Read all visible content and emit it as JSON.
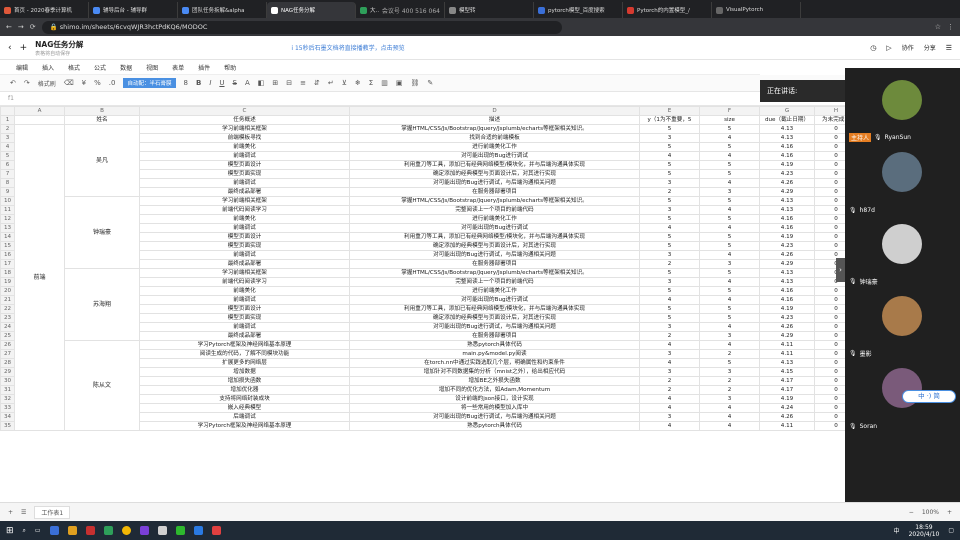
{
  "browser": {
    "tabs": [
      {
        "title": "首页 - 2020春季计算机",
        "icon_color": "#e0583a"
      },
      {
        "title": "辅导后台 - 辅导群",
        "icon_color": "#4a8af4"
      },
      {
        "title": "团队任务拆解&alpha",
        "icon_color": "#4a8af4"
      },
      {
        "title": "NAG任务分解",
        "icon_color": "#ffffff",
        "active": true
      },
      {
        "title": "大规与Pytor",
        "icon_color": "#2e9f5a",
        "overlay": "会议号 400 516 064"
      },
      {
        "title": "模型转",
        "icon_color": "#888888"
      },
      {
        "title": "pytorch模型_百度搜索",
        "icon_color": "#3a6fd8"
      },
      {
        "title": "Pytorch的内置模型_/",
        "icon_color": "#d63a2f"
      },
      {
        "title": "VisualPytorch",
        "icon_color": "#666666"
      }
    ],
    "url": "shimo.im/sheets/6cvqWJR3hctPdKQ6/MODOC"
  },
  "doc": {
    "title": "NAG任务分解",
    "subtitle": "表格将自动保存",
    "notice": "i 15秒后石墨文档将直接播教学，点击预览",
    "collab_button": "协作",
    "share_button": "分享"
  },
  "menu": [
    "编辑",
    "插入",
    "格式",
    "公式",
    "数据",
    "视图",
    "表单",
    "插件",
    "帮助"
  ],
  "toolbar": {
    "format_brush": "格式刷",
    "percent": "%",
    "font_size": "8",
    "highlight_button": "自动配：半石膏膜"
  },
  "sheet": {
    "cell_ref": "f1",
    "col_letters": [
      "A",
      "B",
      "C",
      "D",
      "E",
      "F",
      "G",
      "H"
    ],
    "headers": [
      "",
      "姓名",
      "任务概述",
      "描述",
      "y（1为不重要，5",
      "size",
      "due（截止日期）",
      "为未完成，"
    ],
    "group_label": "前端",
    "merges": [
      {
        "name": "吴凡",
        "start": 0,
        "span": 8
      },
      {
        "name": "钟瑞豪",
        "start": 8,
        "span": 8
      },
      {
        "name": "苏海翔",
        "start": 16,
        "span": 8
      },
      {
        "name": "陈从文",
        "start": 24,
        "span": 10
      }
    ],
    "rows": [
      [
        "学习前端相关框架",
        "掌握HTML/CSS/Js/Bootstrap/Jquery/Jsplumb/echarts等框架相关知识。",
        "5",
        "5",
        "4.13",
        "0"
      ],
      [
        "前端模板寻找",
        "找到合适的前端模板",
        "3",
        "4",
        "4.13",
        "0"
      ],
      [
        "前端美化",
        "进行前端美化工作",
        "5",
        "5",
        "4.16",
        "0"
      ],
      [
        "前端调试",
        "对可能出现的Bug进行调试",
        "4",
        "4",
        "4.16",
        "0"
      ],
      [
        "模型页面设计",
        "利用重刀等工具，添加已有经典网络模型/模块化，并与后端沟通具体实现",
        "5",
        "5",
        "4.19",
        "0"
      ],
      [
        "模型页面实现",
        "确定添加的经典模型与页面设计后，对其进行实现",
        "5",
        "5",
        "4.23",
        "0"
      ],
      [
        "前端调试",
        "对可能出现的Bug进行调试，与后端沟通相关问题",
        "3",
        "4",
        "4.26",
        "0"
      ],
      [
        "最终成品部署",
        "在服务器部署项目",
        "2",
        "3",
        "4.29",
        "0"
      ],
      [
        "学习前端相关框架",
        "掌握HTML/CSS/Js/Bootstrap/Jquery/Jsplumb/echarts等框架相关知识。",
        "5",
        "5",
        "4.13",
        "0"
      ],
      [
        "前端代码阅读学习",
        "完整阅读上一个项目的前端代码",
        "3",
        "4",
        "4.13",
        "0"
      ],
      [
        "前端美化",
        "进行前端美化工作",
        "5",
        "5",
        "4.16",
        "0"
      ],
      [
        "前端调试",
        "对可能出现的Bug进行调试",
        "4",
        "4",
        "4.16",
        "0"
      ],
      [
        "模型页面设计",
        "利用重刀等工具，添加已有经典网络模型/模块化，并与后端沟通具体实现",
        "5",
        "5",
        "4.19",
        "0"
      ],
      [
        "模型页面实现",
        "确定添加的经典模型与页面设计后，对其进行实现",
        "5",
        "5",
        "4.23",
        "0"
      ],
      [
        "前端调试",
        "对可能出现的Bug进行调试，与后端沟通相关问题",
        "3",
        "4",
        "4.26",
        "0"
      ],
      [
        "最终成品部署",
        "在服务器部署项目",
        "2",
        "3",
        "4.29",
        "0"
      ],
      [
        "学习前端相关框架",
        "掌握HTML/CSS/Js/Bootstrap/Jquery/Jsplumb/echarts等框架相关知识。",
        "5",
        "5",
        "4.13",
        "0"
      ],
      [
        "前端代码阅读学习",
        "完整阅读上一个项目的前端代码",
        "3",
        "4",
        "4.13",
        "0"
      ],
      [
        "前端美化",
        "进行前端美化工作",
        "5",
        "5",
        "4.16",
        "0"
      ],
      [
        "前端调试",
        "对可能出现的Bug进行调试",
        "4",
        "4",
        "4.16",
        "0"
      ],
      [
        "模型页面设计",
        "利用重刀等工具，添加已有经典网络模型/模块化，并与后端沟通具体实现",
        "5",
        "5",
        "4.19",
        "0"
      ],
      [
        "模型页面实现",
        "确定添加的经典模型与页面设计后，对其进行实现",
        "5",
        "5",
        "4.23",
        "0"
      ],
      [
        "前端调试",
        "对可能出现的Bug进行调试，与后端沟通相关问题",
        "3",
        "4",
        "4.26",
        "0"
      ],
      [
        "最终成品部署",
        "在服务器部署项目",
        "2",
        "3",
        "4.29",
        "0"
      ],
      [
        "学习Pytorch框架及神经网络基本原理",
        "熟悉pytorch具体代码",
        "4",
        "4",
        "4.11",
        "0"
      ],
      [
        "阅读生成的代码，了解不同模块功能",
        "main.py&model.py阅读",
        "3",
        "2",
        "4.11",
        "0"
      ],
      [
        "扩展更多的网络层",
        "在torch.nn中通过实践选取几个层，明确属性和约束条件",
        "4",
        "5",
        "4.13",
        "0"
      ],
      [
        "增加数据",
        "增加针对不同数据集的分析（mnist之外），给出相应代码",
        "3",
        "3",
        "4.15",
        "0"
      ],
      [
        "增加损失函数",
        "增加BE之外损失函数",
        "2",
        "2",
        "4.17",
        "0"
      ],
      [
        "增加优化器",
        "增加不同的优化方法，如Adam,Momentum",
        "2",
        "2",
        "4.17",
        "0"
      ],
      [
        "支持将网络封装成块",
        "设计前端的json接口，设计实现",
        "4",
        "3",
        "4.19",
        "0"
      ],
      [
        "嵌入经典模型",
        "将一些常用的模型加入库中",
        "4",
        "4",
        "4.24",
        "0"
      ],
      [
        "后端调试",
        "对可能出现的Bug进行调试，与后端沟通相关问题",
        "3",
        "4",
        "4.26",
        "0"
      ],
      [
        "学习Pytorch框架及神经网络基本原理",
        "熟悉pytorch具体代码",
        "4",
        "4",
        "4.11",
        "0"
      ]
    ]
  },
  "bottom": {
    "sheet_tab": "工作表1",
    "zoom": "100%"
  },
  "meeting": {
    "speaking_label": "正在讲话:",
    "host_badge": "主持人",
    "participants": [
      {
        "name": "RyanSun",
        "color": "#6d8a3c"
      },
      {
        "name": "h87d",
        "color": "#5a6d7d"
      },
      {
        "name": "钟瑞豪",
        "color": "#cfcfcf"
      },
      {
        "name": "墨影",
        "color": "#a87a4a"
      },
      {
        "name": "Soran",
        "color": "#7a5a7a"
      }
    ],
    "ime_label": "中 ·) 简"
  },
  "taskbar": {
    "time": "18:59",
    "date": "2020/4/10",
    "lang": "中"
  }
}
